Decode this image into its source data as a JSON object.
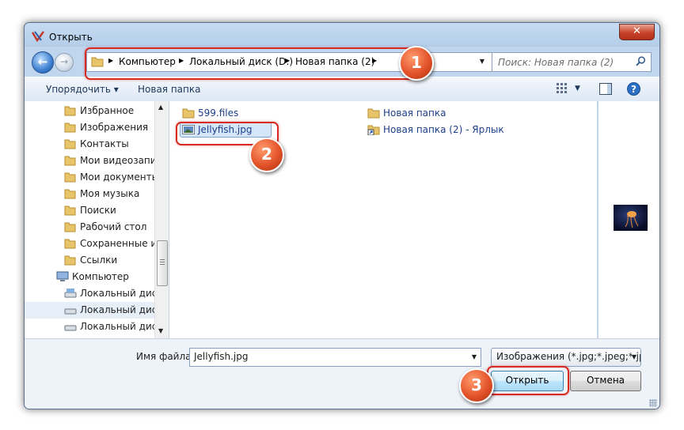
{
  "window": {
    "title": "Открыть"
  },
  "address": {
    "crumbs": [
      "Компьютер",
      "Локальный диск (D:)",
      "Новая папка (2)"
    ],
    "search_placeholder": "Поиск: Новая папка (2)"
  },
  "toolbar": {
    "organize": "Упорядочить",
    "new_folder": "Новая папка"
  },
  "nav": {
    "items": [
      {
        "label": "Избранное",
        "icon": "favorites-folder-icon"
      },
      {
        "label": "Изображения",
        "icon": "pictures-folder-icon"
      },
      {
        "label": "Контакты",
        "icon": "contacts-folder-icon"
      },
      {
        "label": "Мои видеозаписи",
        "icon": "videos-folder-icon"
      },
      {
        "label": "Мои документы",
        "icon": "documents-folder-icon"
      },
      {
        "label": "Моя музыка",
        "icon": "music-folder-icon"
      },
      {
        "label": "Поиски",
        "icon": "searches-folder-icon"
      },
      {
        "label": "Рабочий стол",
        "icon": "desktop-folder-icon"
      },
      {
        "label": "Сохраненные игры",
        "icon": "saved-games-folder-icon"
      },
      {
        "label": "Ссылки",
        "icon": "links-folder-icon"
      },
      {
        "label": "Компьютер",
        "icon": "computer-icon"
      },
      {
        "label": "Локальный диск (C:)",
        "icon": "drive-icon"
      },
      {
        "label": "Локальный диск (D:)",
        "icon": "drive-icon"
      },
      {
        "label": "Локальный диск (E:)",
        "icon": "drive-icon"
      }
    ]
  },
  "files": [
    {
      "name": "599.files",
      "icon": "folder-icon"
    },
    {
      "name": "Jellyfish.jpg",
      "icon": "image-file-icon"
    },
    {
      "name": "Новая папка",
      "icon": "folder-icon"
    },
    {
      "name": "Новая папка (2) - Ярлык",
      "icon": "shortcut-icon"
    }
  ],
  "bottom": {
    "filename_label": "Имя файла:",
    "filename_value": "Jellyfish.jpg",
    "filetype_value": "Изображения (*.jpg;*.jpeg;*.jpg",
    "open_label": "Открыть",
    "cancel_label": "Отмена"
  },
  "annotations": {
    "step1": "1",
    "step2": "2",
    "step3": "3"
  },
  "colors": {
    "highlight": "#d82a20",
    "badge": "#e4532a",
    "link_text": "#1e3f8a"
  }
}
